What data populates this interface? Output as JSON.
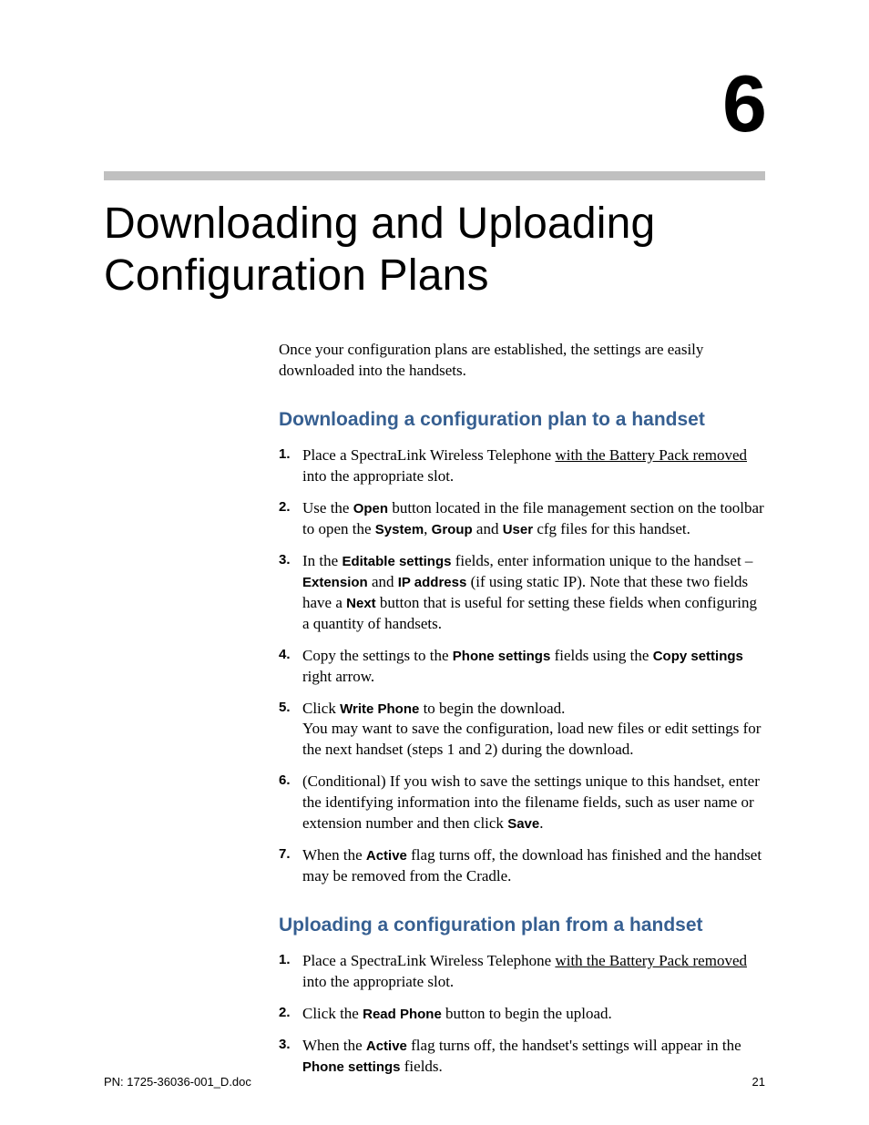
{
  "chapter": {
    "number": "6",
    "title": "Downloading and Uploading Configuration Plans"
  },
  "intro": "Once your configuration plans are established, the settings are easily downloaded into the handsets.",
  "sectionA": {
    "heading": "Downloading a configuration plan to a handset",
    "steps": {
      "s1a": "Place a SpectraLink Wireless Telephone ",
      "s1u": "with the Battery Pack removed",
      "s1b": " into the appropriate slot.",
      "s2a": "Use the ",
      "s2b1": "Open",
      "s2c": " button located in the file management section on the toolbar to open the ",
      "s2b2": "System",
      "s2d": ", ",
      "s2b3": "Group",
      "s2e": " and ",
      "s2b4": "User",
      "s2f": " cfg files for this handset.",
      "s3a": "In the ",
      "s3b1": "Editable settings",
      "s3c": " fields, enter information unique to the handset – ",
      "s3b2": "Extension",
      "s3d": " and ",
      "s3b3": "IP address",
      "s3e": " (if using static IP). Note that these two fields have a ",
      "s3b4": "Next",
      "s3f": " button that is useful for setting these fields when configuring a quantity of handsets.",
      "s4a": "Copy the settings to the ",
      "s4b1": "Phone settings",
      "s4b": " fields using the ",
      "s4b2": "Copy settings",
      "s4c": " right arrow.",
      "s5a": "Click ",
      "s5b1": "Write Phone",
      "s5b": " to begin the download.",
      "s5c": "You may want to save the configuration, load new files or edit settings for the next handset (steps 1 and 2) during the download.",
      "s6a": "(Conditional) If you wish to save the settings unique to this handset, enter the identifying information into the filename fields, such as user name or extension number and then click ",
      "s6b1": "Save",
      "s6b": ".",
      "s7a": "When the ",
      "s7b1": "Active",
      "s7b": " flag turns off, the download has finished and the handset may be removed from the Cradle."
    }
  },
  "sectionB": {
    "heading": "Uploading a configuration plan from a handset",
    "steps": {
      "s1a": "Place a SpectraLink Wireless Telephone ",
      "s1u": "with the Battery Pack removed",
      "s1b": " into the appropriate slot.",
      "s2a": "Click the ",
      "s2b1": "Read Phone",
      "s2b": " button to begin the upload.",
      "s3a": "When the ",
      "s3b1": "Active",
      "s3b": " flag turns off, the handset's settings will appear in the ",
      "s3b2": "Phone settings",
      "s3c": " fields."
    }
  },
  "footer": {
    "left": "PN: 1725-36036-001_D.doc",
    "right": "21"
  }
}
